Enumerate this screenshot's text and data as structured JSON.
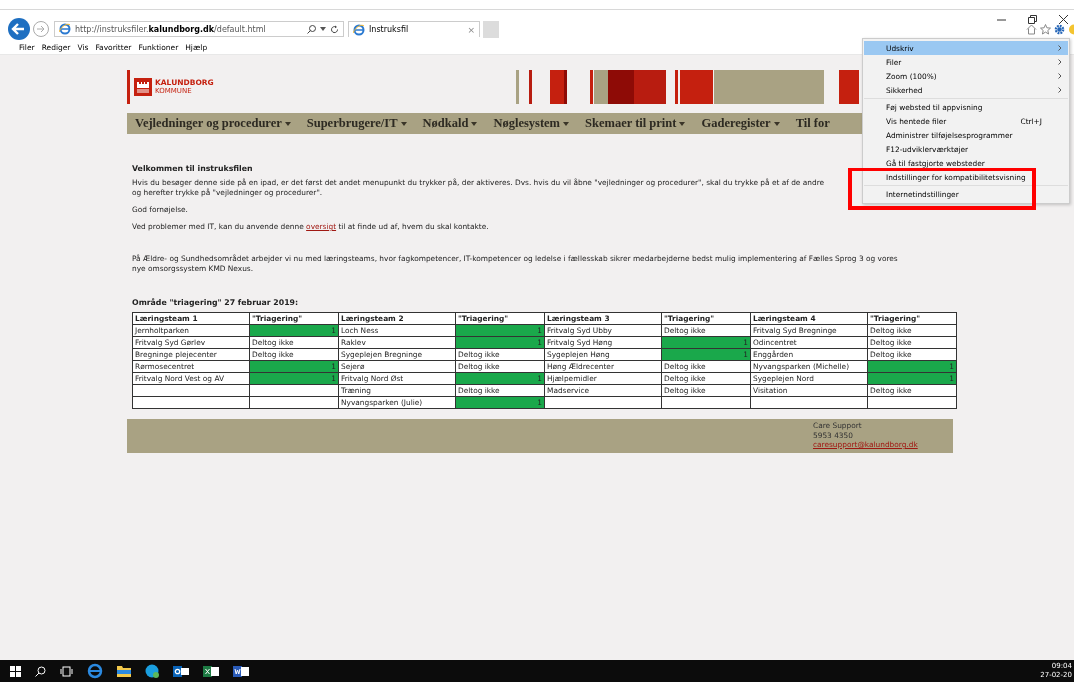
{
  "browser": {
    "address": "http://instruksfiler.**kalundborg.dk**/default.html",
    "tab": {
      "title": "Instruksfil",
      "close": "×"
    },
    "menu_bar": [
      "Filer",
      "Rediger",
      "Vis",
      "Favoritter",
      "Funktioner",
      "Hjælp"
    ]
  },
  "tools_menu": {
    "groups": [
      [
        {
          "label": "Udskriv",
          "submenu": true,
          "selected": true
        },
        {
          "label": "Filer",
          "submenu": true,
          "selected": false
        },
        {
          "label": "Zoom (100%)",
          "submenu": true,
          "selected": false
        },
        {
          "label": "Sikkerhed",
          "submenu": true,
          "selected": false
        }
      ],
      [
        {
          "label": "Føj websted til appvisning",
          "submenu": false,
          "selected": false
        },
        {
          "label": "Vis hentede filer",
          "shortcut": "Ctrl+J",
          "submenu": false,
          "selected": false
        },
        {
          "label": "Administrer tilføjelsesprogrammer",
          "submenu": false,
          "selected": false
        },
        {
          "label": "F12-udviklerværktøjer",
          "submenu": false,
          "selected": false
        },
        {
          "label": "Gå til fastgjorte websteder",
          "submenu": false,
          "selected": false
        },
        {
          "label": "Indstillinger for kompatibilitetsvisning",
          "submenu": false,
          "selected": false
        }
      ],
      [
        {
          "label": "Internetindstillinger",
          "submenu": false,
          "selected": false
        }
      ]
    ]
  },
  "site": {
    "logo": {
      "name": "KALUNDBORG",
      "sub": "KOMMUNE"
    },
    "nav": [
      "Vejledninger og procedurer",
      "Superbrugere/IT",
      "Nødkald",
      "Nøglesystem",
      "Skemaer til print",
      "Gaderegister",
      "Til for"
    ],
    "welcome_title": "Velkommen til instruksfilen",
    "intro_lines": [
      "Hvis du besøger denne side på en ipad, er det først det andet menupunkt du trykker på, der aktiveres. Dvs. hvis du vil åbne \"vejledninger og procedurer\", skal du trykke på et af de andre",
      "og herefter trykke på \"vejledninger og procedurer\"."
    ],
    "greeting": "God fornøjelse.",
    "it_help": {
      "before": "Ved problemer med IT, kan du anvende denne",
      "link": "oversigt",
      "after": "til at finde ud af, hvem du skal kontakte."
    },
    "teams_lines": [
      "På Ældre- og Sundhedsområdet arbejder vi nu med læringsteams, hvor fagkompetencer, IT-kompetencer og ledelse i fællesskab sikrer medarbejderne bedst mulig implementering af Fælles Sprog 3 og vores",
      "nye omsorgssystem KMD Nexus."
    ],
    "table_title": "Område \"triagering\" 27 februar 2019:",
    "table": {
      "columns": [
        "Læringsteam 1",
        "\"Triagering\"",
        "Læringsteam 2",
        "\"Triagering\"",
        "Læringsteam 3",
        "\"Triagering\"",
        "Læringsteam 4",
        "\"Triagering\""
      ],
      "rows": [
        [
          {
            "text": "Jernholtparken",
            "participated": false
          },
          {
            "text": "1",
            "participated": true
          },
          {
            "text": "Loch Ness",
            "participated": false
          },
          {
            "text": "1",
            "participated": true
          },
          {
            "text": "Fritvalg Syd Ubby",
            "participated": false
          },
          {
            "text": "Deltog ikke",
            "participated": false
          },
          {
            "text": "Fritvalg Syd Bregninge",
            "participated": false
          },
          {
            "text": "Deltog ikke",
            "participated": false
          }
        ],
        [
          {
            "text": "Fritvalg Syd Gørlev",
            "participated": false
          },
          {
            "text": "Deltog ikke",
            "participated": false
          },
          {
            "text": "Raklev",
            "participated": false
          },
          {
            "text": "1",
            "participated": true
          },
          {
            "text": "Fritvalg Syd Høng",
            "participated": false
          },
          {
            "text": "1",
            "participated": true
          },
          {
            "text": "Odincentret",
            "participated": false
          },
          {
            "text": "Deltog ikke",
            "participated": false
          }
        ],
        [
          {
            "text": "Bregninge plejecenter",
            "participated": false
          },
          {
            "text": "Deltog ikke",
            "participated": false
          },
          {
            "text": "Sygeplejen Bregninge",
            "participated": false
          },
          {
            "text": "Deltog ikke",
            "participated": false
          },
          {
            "text": "Sygeplejen Høng",
            "participated": false
          },
          {
            "text": "1",
            "participated": true
          },
          {
            "text": "Enggården",
            "participated": false
          },
          {
            "text": "Deltog ikke",
            "participated": false
          }
        ],
        [
          {
            "text": "Rørmosecentret",
            "participated": false
          },
          {
            "text": "1",
            "participated": true
          },
          {
            "text": "Sejerø",
            "participated": false
          },
          {
            "text": "Deltog ikke",
            "participated": false
          },
          {
            "text": "Høng Ældrecenter",
            "participated": false
          },
          {
            "text": "Deltog ikke",
            "participated": false
          },
          {
            "text": "Nyvangsparken (Michelle)",
            "participated": false
          },
          {
            "text": "1",
            "participated": true
          }
        ],
        [
          {
            "text": "Fritvalg Nord Vest og AV",
            "participated": false
          },
          {
            "text": "1",
            "participated": true
          },
          {
            "text": "Fritvalg Nord Øst",
            "participated": false
          },
          {
            "text": "1",
            "participated": true
          },
          {
            "text": "Hjælpemidler",
            "participated": false
          },
          {
            "text": "Deltog ikke",
            "participated": false
          },
          {
            "text": "Sygeplejen Nord",
            "participated": false
          },
          {
            "text": "1",
            "participated": true
          }
        ],
        [
          {
            "participated": false
          },
          {
            "participated": false
          },
          {
            "text": "Træning",
            "participated": false
          },
          {
            "text": "Deltog ikke",
            "participated": false
          },
          {
            "text": "Madservice",
            "participated": false
          },
          {
            "text": "Deltog ikke",
            "participated": false
          },
          {
            "text": "Visitation",
            "participated": false
          },
          {
            "text": "Deltog ikke",
            "participated": false
          }
        ],
        [
          {
            "participated": false
          },
          {
            "participated": false
          },
          {
            "text": "Nyvangsparken (Julie)",
            "participated": false
          },
          {
            "text": "1",
            "participated": true
          },
          {
            "participated": false
          },
          {
            "participated": false
          },
          {
            "participated": false
          },
          {
            "participated": false
          }
        ]
      ]
    },
    "footer": {
      "lines": [
        "Care Support",
        "5953 4350"
      ],
      "email": "caresupport@kalundborg.dk"
    }
  },
  "taskbar": {
    "time": "09:04",
    "date": "27-02-20"
  }
}
